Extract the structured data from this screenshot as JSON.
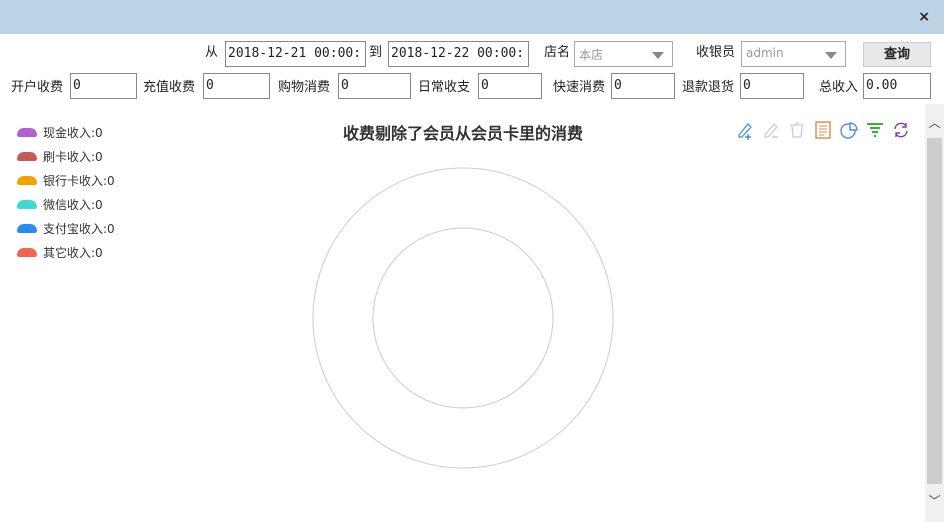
{
  "window": {
    "close": "×"
  },
  "filters": {
    "from_label": "从",
    "from_value": "2018-12-21 00:00:",
    "to_label": "到",
    "to_value": "2018-12-22 00:00:",
    "store_label": "店名",
    "store_value": "本店",
    "cashier_label": "收银员",
    "cashier_value": "admin",
    "query_button": "查询"
  },
  "totals": [
    {
      "label": "开户收费",
      "value": "0"
    },
    {
      "label": "充值收费",
      "value": "0"
    },
    {
      "label": "购物消费",
      "value": "0"
    },
    {
      "label": "日常收支",
      "value": "0"
    },
    {
      "label": "快速消费",
      "value": "0"
    },
    {
      "label": "退款退货",
      "value": "0"
    },
    {
      "label": "总收入",
      "value": "0.00"
    }
  ],
  "chart_data": {
    "type": "pie",
    "title": "收费剔除了会员从会员卡里的消费",
    "legend_position": "top-left",
    "series": [
      {
        "name": "现金收入:0",
        "value": 0,
        "color": "#b35fd0"
      },
      {
        "name": "刷卡收入:0",
        "value": 0,
        "color": "#c65a5a"
      },
      {
        "name": "银行卡收入:0",
        "value": 0,
        "color": "#f5a200"
      },
      {
        "name": "微信收入:0",
        "value": 0,
        "color": "#40d9cf"
      },
      {
        "name": "支付宝收入:0",
        "value": 0,
        "color": "#2a8cf0"
      },
      {
        "name": "其它收入:0",
        "value": 0,
        "color": "#f0664e"
      }
    ]
  },
  "toolbar": [
    "add-edit-icon",
    "remove-edit-icon",
    "delete-icon",
    "report-icon",
    "pie-chart-icon",
    "filter-icon",
    "refresh-icon"
  ]
}
